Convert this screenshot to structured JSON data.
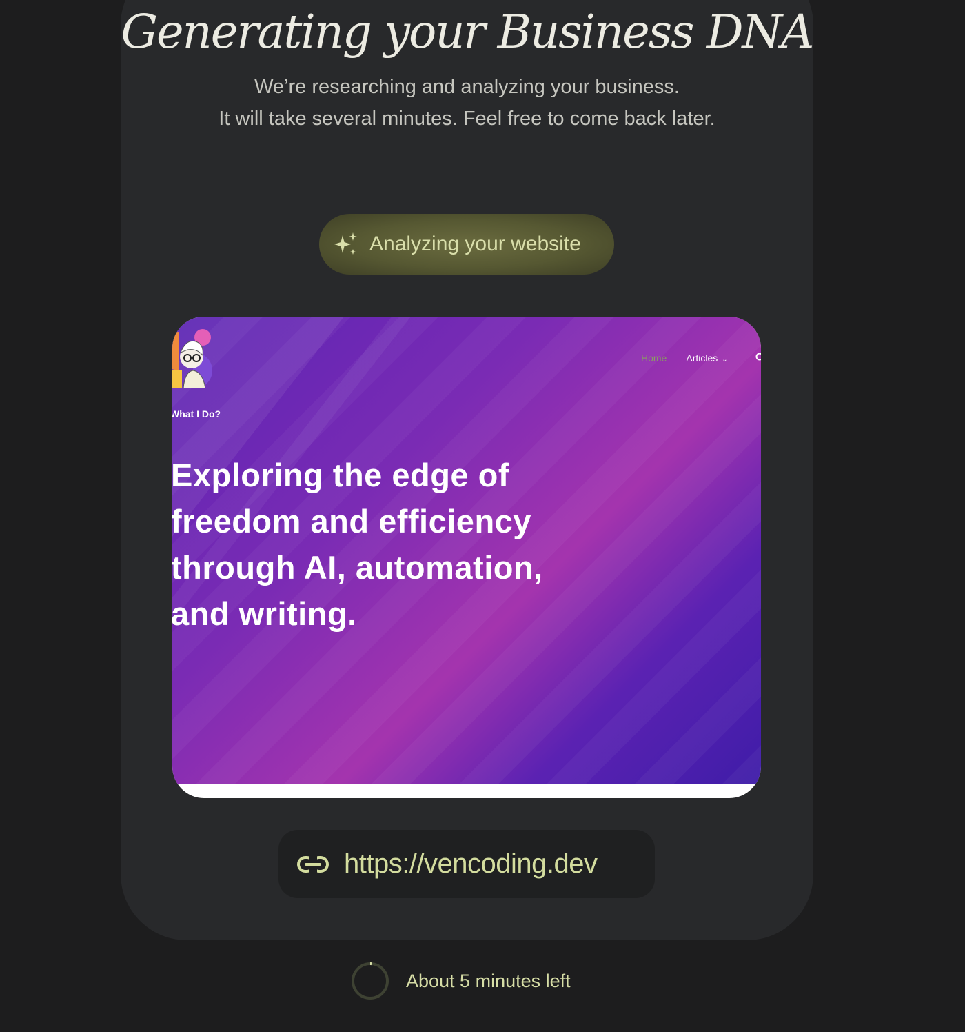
{
  "header": {
    "title": "Generating your Business DNA",
    "subtitle_line1": "We’re researching and analyzing your business.",
    "subtitle_line2": "It will take several minutes. Feel free to come back later."
  },
  "status": {
    "icon": "sparkle-icon",
    "label": "Analyzing your website"
  },
  "preview": {
    "nav": {
      "home_label": "Home",
      "articles_label": "Articles",
      "articles_icon": "chevron-down-icon",
      "search_icon": "search-icon"
    },
    "section_label": "What I Do?",
    "hero_lines": [
      "Exploring the edge of",
      "freedom and efficiency",
      "through AI, automation,",
      "and writing."
    ]
  },
  "url": {
    "icon": "link-icon",
    "text": "https://vencoding.dev"
  },
  "eta": {
    "icon": "spinner-icon",
    "text": "About 5 minutes left"
  },
  "colors": {
    "page_background": "#1d1d1e",
    "card_background": "#28292b",
    "accent": "#d3dc9e",
    "preview_gradient_start": "#5b24b3",
    "preview_gradient_mid": "#a434ae"
  }
}
